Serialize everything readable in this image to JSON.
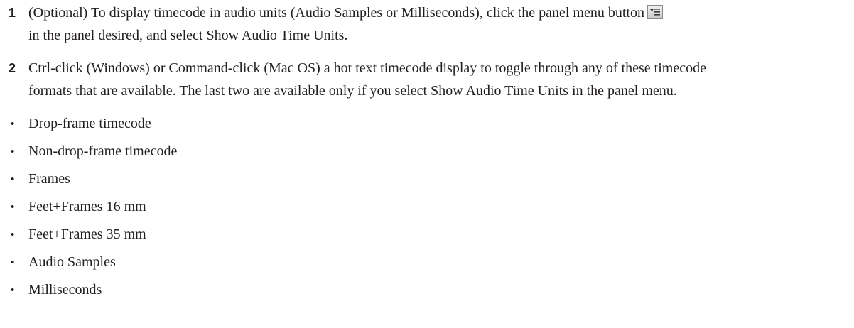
{
  "steps": [
    {
      "number": "1",
      "line1": "(Optional) To display timecode in audio units (Audio Samples or Milliseconds), click the panel menu button",
      "line2": "in the panel desired, and select Show Audio Time Units.",
      "icon": "panel-menu-icon"
    },
    {
      "number": "2",
      "line1": "Ctrl-click (Windows) or Command-click (Mac OS) a hot text timecode display to toggle through any of these timecode",
      "line2": "formats that are available. The last two are available only if you select Show Audio Time Units in the panel menu."
    }
  ],
  "bullet_symbol": "•",
  "formats": [
    "Drop-frame timecode",
    "Non-drop-frame timecode",
    "Frames",
    "Feet+Frames 16 mm",
    "Feet+Frames 35 mm",
    "Audio Samples",
    "Milliseconds"
  ]
}
